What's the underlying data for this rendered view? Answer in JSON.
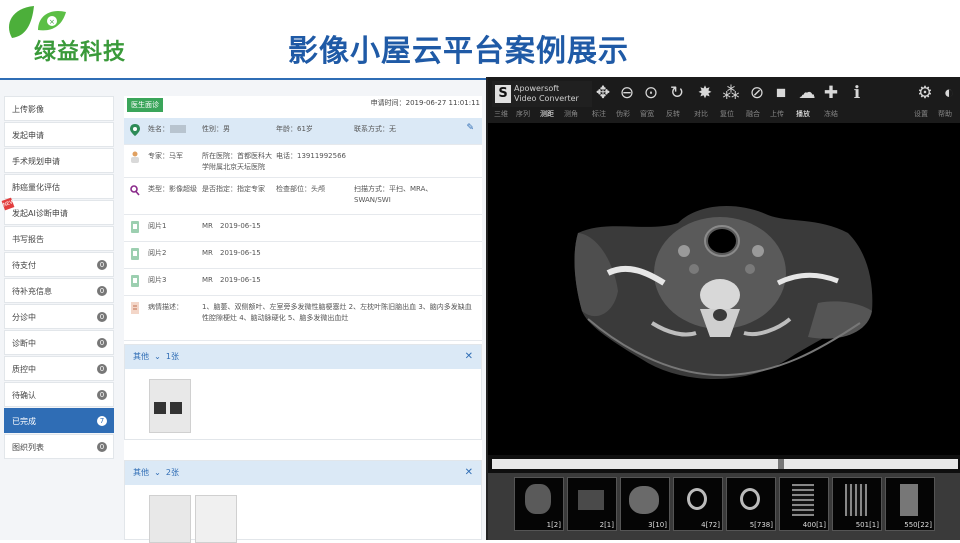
{
  "header": {
    "logo_text": "绿益科技",
    "title": "影像小屋云平台案例展示",
    "brand_green": "#3a9a3a",
    "title_blue": "#1f5aa6"
  },
  "sidebar": {
    "items": [
      {
        "label": "上传影像"
      },
      {
        "label": "发起申请"
      },
      {
        "label": "手术规划申请"
      },
      {
        "label": "肺癌量化评估"
      },
      {
        "label": "发起AI诊断申请",
        "flag": "NEW"
      },
      {
        "label": "书写报告"
      },
      {
        "label": "待支付",
        "count": "0"
      },
      {
        "label": "待补充信息",
        "count": "0"
      },
      {
        "label": "分诊中",
        "count": "0"
      },
      {
        "label": "诊断中",
        "count": "0"
      },
      {
        "label": "质控中",
        "count": "0"
      },
      {
        "label": "待确认",
        "count": "0"
      },
      {
        "label": "已完成",
        "count": "7",
        "active": true
      },
      {
        "label": "图织列表",
        "count": "0"
      }
    ]
  },
  "case": {
    "status": "医生面诊",
    "apply_time": "申请时间：2019-06-27 11:01:11",
    "patient": {
      "name": "姓名：",
      "gender": "性别：男",
      "age": "年龄：61岁",
      "contact": "联系方式：无"
    },
    "expert": {
      "name": "专家：马军",
      "hospital": "所在医院：首都医科大学附属北京天坛医院",
      "phone": "电话：13911992566"
    },
    "type": {
      "type": "类型：影像超级",
      "assign": "是否指定：指定专家",
      "part": "检查部位：头颅",
      "scan": "扫描方式：平扫、MRA、SWAN/SWI"
    },
    "films": [
      {
        "name": "阅片1",
        "modality": "MR",
        "date": "2019-06-15"
      },
      {
        "name": "阅片2",
        "modality": "MR",
        "date": "2019-06-15"
      },
      {
        "name": "阅片3",
        "modality": "MR",
        "date": "2019-06-15"
      }
    ],
    "history_label": "病情描述：",
    "history_text": "1、脑萎、双侧额叶、左室旁多发微性脑梗塞灶 2、左枕叶陈旧脑出血 3、脑内多发缺血性腔隙梗灶 4、脑动脉硬化 5、脑多发微出血灶"
  },
  "panels": [
    {
      "title": "其他",
      "size": "1张"
    },
    {
      "title": "其他",
      "size": "2张"
    }
  ],
  "viewer": {
    "badge_line1": "Apowersoft",
    "badge_line2": "Video Converter",
    "badge_letter": "S",
    "tool_icons": [
      "✥",
      "⊖",
      "⊙",
      "↻",
      "✸",
      "⁂",
      "⊘",
      "■",
      "☁",
      "✚",
      "ℹ",
      "⚙",
      "◐"
    ],
    "tool_labels": [
      "三维",
      "序列",
      "测距",
      "测角",
      "标注",
      "伪彩",
      "窗宽",
      "反转",
      "对比",
      "复位",
      "融合",
      "上传",
      "播放",
      "冻结",
      "设置",
      "帮助"
    ],
    "series": [
      {
        "label": "1[2]"
      },
      {
        "label": "2[1]"
      },
      {
        "label": "3[10]"
      },
      {
        "label": "4[72]"
      },
      {
        "label": "5[738]"
      },
      {
        "label": "400[1]"
      },
      {
        "label": "501[1]"
      },
      {
        "label": "550[22]"
      }
    ]
  }
}
